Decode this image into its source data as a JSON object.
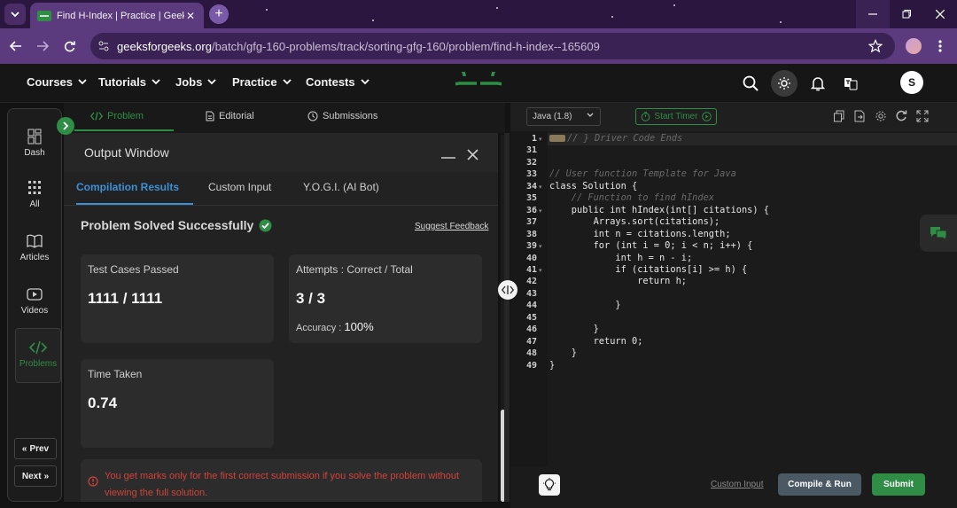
{
  "browser": {
    "tab_title": "Find H-Index | Practice | GeeksforGeeks",
    "url_host": "geeksforgeeks.org",
    "url_path": "/batch/gfg-160-problems/track/sorting-gfg-160/problem/find-h-index--165609",
    "profile_initial": ""
  },
  "site": {
    "nav": [
      "Courses",
      "Tutorials",
      "Jobs",
      "Practice",
      "Contests"
    ],
    "user_initial": "S",
    "accent": "#2f8d46"
  },
  "rail": {
    "items": [
      "Dash",
      "All",
      "Articles",
      "Videos",
      "Problems"
    ],
    "prev": "Prev",
    "next": "Next"
  },
  "problem_tabs": [
    "Problem",
    "Editorial",
    "Submissions"
  ],
  "output": {
    "title": "Output Window",
    "tabs": [
      "Compilation Results",
      "Custom Input",
      "Y.O.G.I. (AI Bot)"
    ],
    "status": "Problem Solved Successfully",
    "feedback": "Suggest Feedback",
    "test_cases_label": "Test Cases Passed",
    "test_cases_value": "1111 / 1111",
    "attempts_label": "Attempts : Correct / Total",
    "attempts_value": "3 / 3",
    "accuracy_label": "Accuracy :",
    "accuracy_value": "100%",
    "time_label": "Time Taken",
    "time_value": "0.74",
    "notice": "You get marks only for the first correct submission if you solve the problem without viewing the full solution."
  },
  "editor": {
    "language": "Java (1.8)",
    "timer": "Start Timer",
    "line_numbers": [
      "1",
      "31",
      "32",
      "33",
      "34",
      "35",
      "36",
      "37",
      "38",
      "39",
      "40",
      "41",
      "42",
      "43",
      "44",
      "45",
      "46",
      "47",
      "48",
      "49"
    ],
    "lines": [
      "// } Driver Code Ends",
      "",
      "",
      "// User function Template for Java",
      "class Solution {",
      "    // Function to find hIndex",
      "    public int hIndex(int[] citations) {",
      "        Arrays.sort(citations);",
      "        int n = citations.length;",
      "        for (int i = 0; i < n; i++) {",
      "            int h = n - i;",
      "            if (citations[i] >= h) {",
      "                return h;",
      "            ",
      "            }",
      "",
      "        }",
      "        return 0;",
      "    }",
      "}"
    ],
    "custom_input": "Custom Input",
    "compile": "Compile & Run",
    "submit": "Submit"
  }
}
